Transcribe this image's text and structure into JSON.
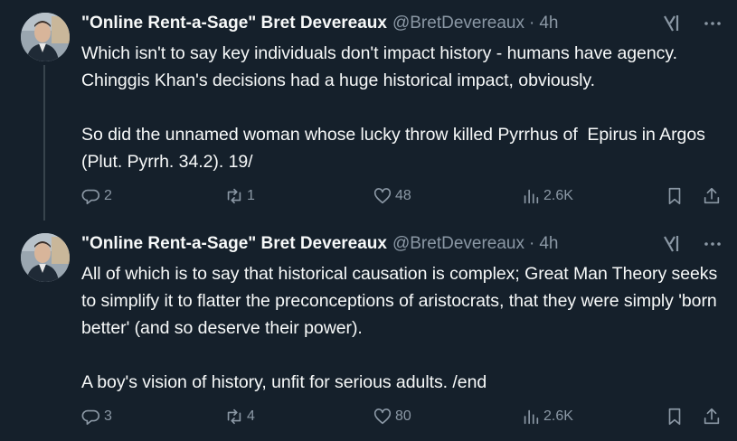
{
  "tweets": [
    {
      "display_name": "\"Online Rent-a-Sage\" Bret Devereaux",
      "handle": "@BretDevereaux",
      "separator": "·",
      "time": "4h",
      "text": "Which isn't to say key individuals don't impact history - humans have agency. Chinggis Khan's decisions had a huge historical impact, obviously.\n\nSo did the unnamed woman whose lucky throw killed Pyrrhus of  Epirus in Argos (Plut. Pyrrh. 34.2). 19/",
      "replies": "2",
      "reposts": "1",
      "likes": "48",
      "views": "2.6K"
    },
    {
      "display_name": "\"Online Rent-a-Sage\" Bret Devereaux",
      "handle": "@BretDevereaux",
      "separator": "·",
      "time": "4h",
      "text": "All of which is to say that historical causation is complex; Great Man Theory seeks to simplify it to flatter the preconceptions of aristocrats, that they were simply 'born better' (and so deserve their power).\n\nA boy's vision of history, unfit for serious adults. /end",
      "replies": "3",
      "reposts": "4",
      "likes": "80",
      "views": "2.6K"
    }
  ],
  "colors": {
    "background": "#15202b",
    "text": "#f7f9f9",
    "secondary": "#8b98a5",
    "thread_line": "#38444d"
  },
  "icons": [
    "grok-icon",
    "more-icon",
    "reply-icon",
    "repost-icon",
    "like-icon",
    "views-icon",
    "bookmark-icon",
    "share-icon"
  ]
}
